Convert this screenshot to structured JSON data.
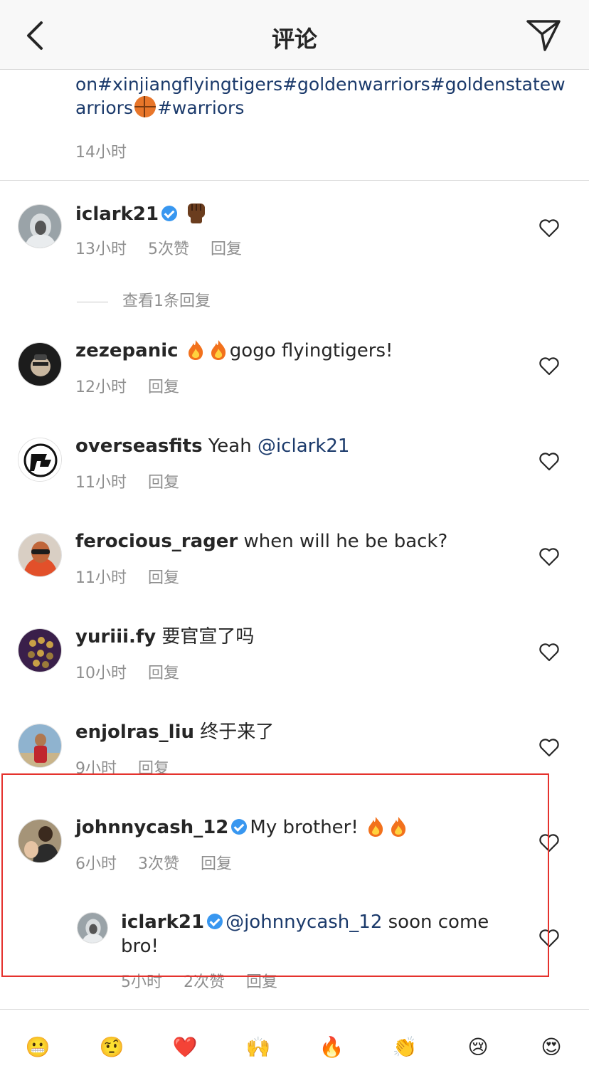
{
  "header": {
    "title": "评论"
  },
  "caption": {
    "text_before": "ociation#chinesebasketball#chinesebasketballassociation#xinjiangflyingtigers#goldenwarriors#goldenstatewarriors",
    "text_after": "#warriors",
    "time": "14小时"
  },
  "comments": [
    {
      "username": "iclark21",
      "verified": true,
      "text": "",
      "time": "13小时",
      "likes": "5次赞",
      "reply": "回复"
    },
    {
      "username": "zezepanic",
      "text": "gogo flyingtigers!",
      "time": "12小时",
      "reply": "回复"
    },
    {
      "username": "overseasfits",
      "text": "Yeah",
      "mention": "@iclark21",
      "time": "11小时",
      "reply": "回复"
    },
    {
      "username": "ferocious_rager",
      "text": "when will he be back?",
      "time": "11小时",
      "reply": "回复"
    },
    {
      "username": "yuriii.fy",
      "text": "要官宣了吗",
      "time": "10小时",
      "reply": "回复"
    },
    {
      "username": "enjolras_liu",
      "text": "终于来了",
      "time": "9小时",
      "reply": "回复"
    },
    {
      "username": "johnnycash_12",
      "verified": true,
      "text": "My brother!",
      "time": "6小时",
      "likes": "3次赞",
      "reply": "回复"
    }
  ],
  "view_replies": "查看1条回复",
  "reply": {
    "username": "iclark21",
    "verified": true,
    "mention": "@johnnycash_12",
    "text": "soon come bro!",
    "time": "5小时",
    "likes": "2次赞",
    "reply": "回复"
  },
  "emoji_bar": [
    "😬",
    "🤨",
    "❤️",
    "🙌",
    "🔥",
    "👏",
    "😢",
    "😍"
  ],
  "colors": {
    "link": "#1b3a6b",
    "meta": "#8e8e8e",
    "verified": "#3897f0",
    "highlight": "#e5322d"
  }
}
